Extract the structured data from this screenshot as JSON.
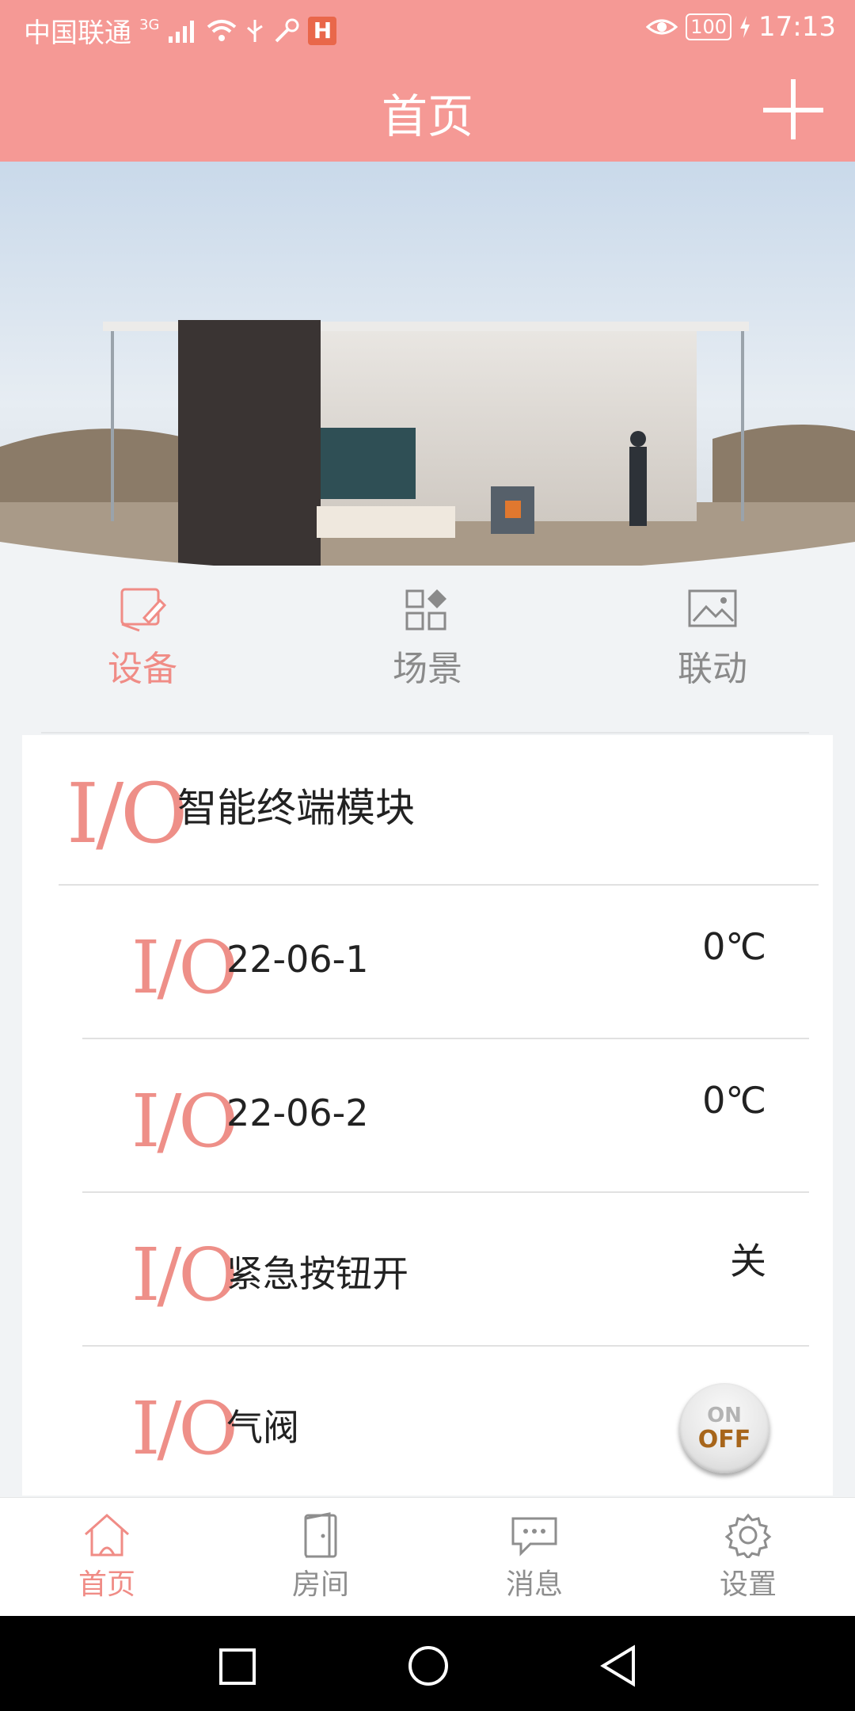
{
  "status_bar": {
    "carrier": "中国联通",
    "network": "3G",
    "battery": "100",
    "time": "17:13"
  },
  "header": {
    "title": "首页"
  },
  "tabs": [
    {
      "label": "设备",
      "icon": "device-edit-icon",
      "active": true
    },
    {
      "label": "场景",
      "icon": "scene-grid-icon",
      "active": false
    },
    {
      "label": "联动",
      "icon": "linkage-image-icon",
      "active": false
    }
  ],
  "device_group": {
    "icon_text": "I/O",
    "title": "智能终端模块"
  },
  "devices": [
    {
      "icon_text": "I/O",
      "name": "22-06-1",
      "value": "0℃"
    },
    {
      "icon_text": "I/O",
      "name": "22-06-2",
      "value": "0℃"
    },
    {
      "icon_text": "I/O",
      "name": "紧急按钮开",
      "value": "关"
    },
    {
      "icon_text": "I/O",
      "name": "气阀",
      "switch_on": "ON",
      "switch_off": "OFF"
    }
  ],
  "bottom_nav": [
    {
      "label": "首页",
      "icon": "home-icon",
      "active": true
    },
    {
      "label": "房间",
      "icon": "door-icon",
      "active": false
    },
    {
      "label": "消息",
      "icon": "message-icon",
      "active": false
    },
    {
      "label": "设置",
      "icon": "gear-icon",
      "active": false
    }
  ],
  "colors": {
    "accent": "#f59995",
    "accent_text": "#f08c86",
    "inactive": "#8e8e8e"
  }
}
